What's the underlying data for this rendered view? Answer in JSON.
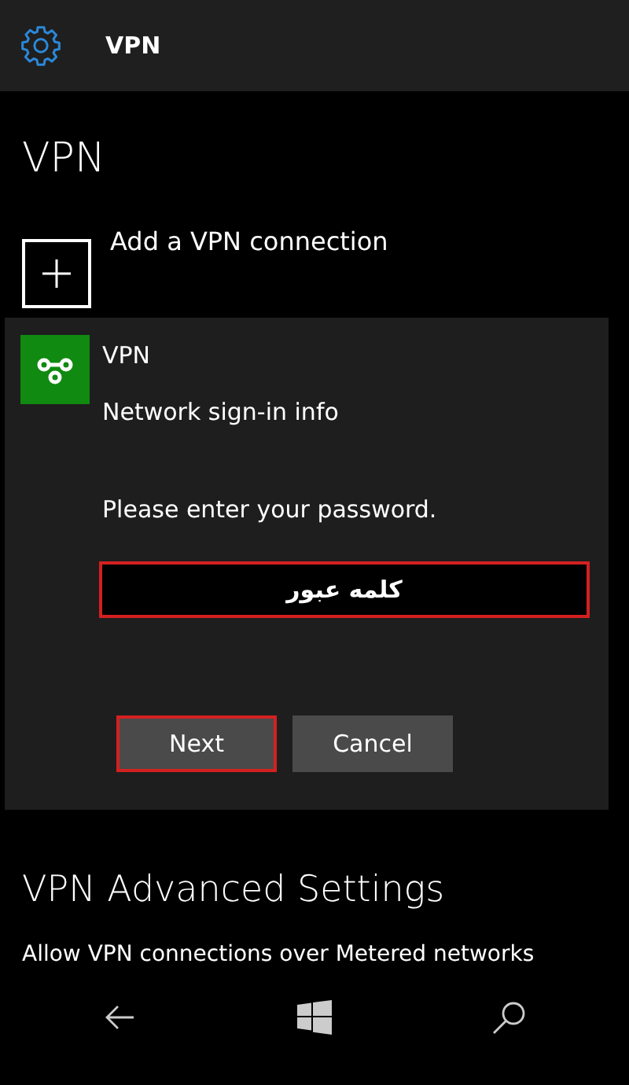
{
  "header": {
    "title": "VPN"
  },
  "page_title": "VPN",
  "add_connection": {
    "label": "Add a VPN connection"
  },
  "dialog": {
    "app_name": "VPN",
    "subtitle": "Network sign-in info",
    "prompt": "Please enter your password.",
    "password_field": {
      "value": "کلمه عبور",
      "highlighted": true
    },
    "buttons": [
      {
        "label": "Next",
        "highlighted": true
      },
      {
        "label": "Cancel",
        "highlighted": false
      }
    ]
  },
  "advanced": {
    "title": "VPN Advanced Settings",
    "option": "Allow VPN connections over Metered networks"
  }
}
